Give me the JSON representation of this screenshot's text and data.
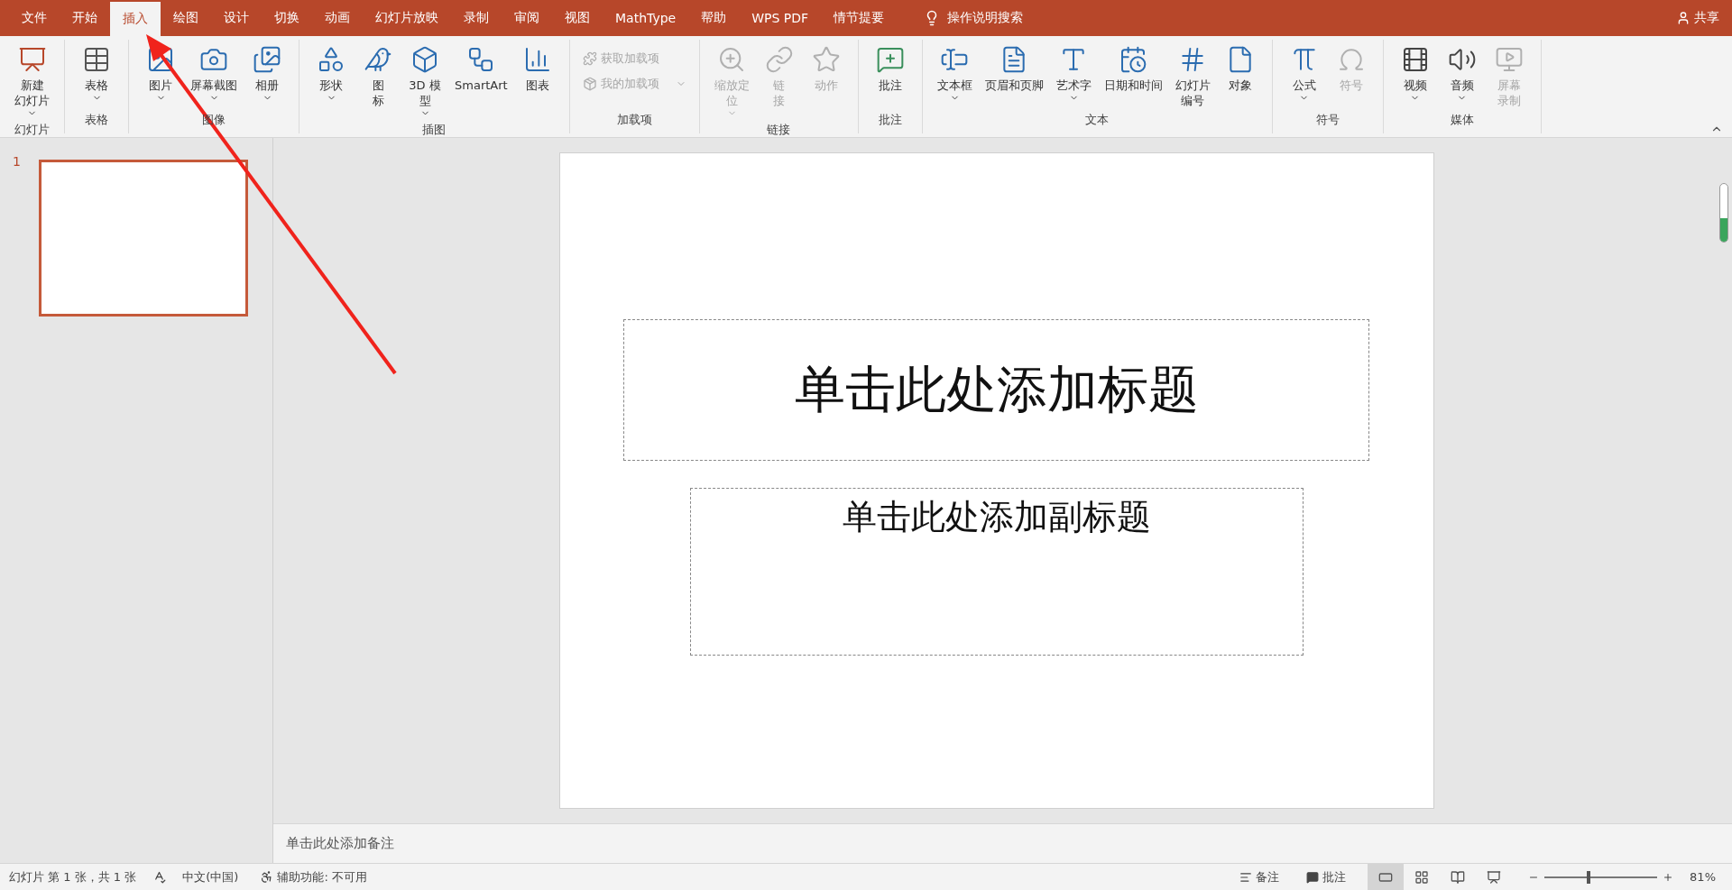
{
  "tabs": [
    {
      "label": "文件",
      "selected": false
    },
    {
      "label": "开始",
      "selected": false
    },
    {
      "label": "插入",
      "selected": true
    },
    {
      "label": "绘图",
      "selected": false
    },
    {
      "label": "设计",
      "selected": false
    },
    {
      "label": "切换",
      "selected": false
    },
    {
      "label": "动画",
      "selected": false
    },
    {
      "label": "幻灯片放映",
      "selected": false
    },
    {
      "label": "录制",
      "selected": false
    },
    {
      "label": "审阅",
      "selected": false
    },
    {
      "label": "视图",
      "selected": false
    },
    {
      "label": "MathType",
      "selected": false
    },
    {
      "label": "帮助",
      "selected": false
    },
    {
      "label": "WPS PDF",
      "selected": false
    },
    {
      "label": "情节提要",
      "selected": false
    }
  ],
  "tell_me": "操作说明搜索",
  "share": "共享",
  "ribbon_groups": [
    {
      "label": "幻灯片",
      "items": [
        {
          "kind": "large",
          "lines": [
            "新建",
            "幻灯片"
          ],
          "dropdown": true,
          "disabled": false
        }
      ]
    },
    {
      "label": "表格",
      "items": [
        {
          "kind": "large",
          "lines": [
            "表格"
          ],
          "dropdown": true,
          "disabled": false
        }
      ]
    },
    {
      "label": "图像",
      "items": [
        {
          "kind": "large",
          "lines": [
            "图片"
          ],
          "dropdown": true,
          "disabled": false
        },
        {
          "kind": "large",
          "lines": [
            "屏幕截图"
          ],
          "dropdown": true,
          "disabled": false
        },
        {
          "kind": "large",
          "lines": [
            "相册"
          ],
          "dropdown": true,
          "disabled": false
        }
      ]
    },
    {
      "label": "插图",
      "items": [
        {
          "kind": "large",
          "lines": [
            "形状"
          ],
          "dropdown": true,
          "disabled": false
        },
        {
          "kind": "large",
          "lines": [
            "图",
            "标"
          ],
          "dropdown": false,
          "disabled": false
        },
        {
          "kind": "large",
          "lines": [
            "3D 模",
            "型"
          ],
          "dropdown": true,
          "disabled": false
        },
        {
          "kind": "large",
          "lines": [
            "SmartArt"
          ],
          "dropdown": false,
          "disabled": false
        },
        {
          "kind": "large",
          "lines": [
            "图表"
          ],
          "dropdown": false,
          "disabled": false
        }
      ]
    },
    {
      "label": "加载项",
      "items": [
        {
          "kind": "small",
          "lines": [
            "获取加载项"
          ],
          "dropdown": false,
          "disabled": true
        },
        {
          "kind": "small",
          "lines": [
            "我的加载项"
          ],
          "dropdown": true,
          "disabled": true
        }
      ]
    },
    {
      "label": "链接",
      "items": [
        {
          "kind": "large",
          "lines": [
            "缩放定",
            "位"
          ],
          "dropdown": true,
          "disabled": true
        },
        {
          "kind": "large",
          "lines": [
            "链",
            "接"
          ],
          "dropdown": false,
          "disabled": true
        },
        {
          "kind": "large",
          "lines": [
            "动作"
          ],
          "dropdown": false,
          "disabled": true
        }
      ]
    },
    {
      "label": "批注",
      "items": [
        {
          "kind": "large",
          "lines": [
            "批注"
          ],
          "dropdown": false,
          "disabled": false
        }
      ]
    },
    {
      "label": "文本",
      "items": [
        {
          "kind": "large",
          "lines": [
            "文本框"
          ],
          "dropdown": true,
          "disabled": false
        },
        {
          "kind": "large",
          "lines": [
            "页眉和页脚"
          ],
          "dropdown": false,
          "disabled": false
        },
        {
          "kind": "large",
          "lines": [
            "艺术字"
          ],
          "dropdown": true,
          "disabled": false
        },
        {
          "kind": "large",
          "lines": [
            "日期和时间"
          ],
          "dropdown": false,
          "disabled": false
        },
        {
          "kind": "large",
          "lines": [
            "幻灯片",
            "编号"
          ],
          "dropdown": false,
          "disabled": false
        },
        {
          "kind": "large",
          "lines": [
            "对象"
          ],
          "dropdown": false,
          "disabled": false
        }
      ]
    },
    {
      "label": "符号",
      "items": [
        {
          "kind": "large",
          "lines": [
            "公式"
          ],
          "dropdown": true,
          "disabled": false
        },
        {
          "kind": "large",
          "lines": [
            "符号"
          ],
          "dropdown": false,
          "disabled": true
        }
      ]
    },
    {
      "label": "媒体",
      "items": [
        {
          "kind": "large",
          "lines": [
            "视频"
          ],
          "dropdown": true,
          "disabled": false
        },
        {
          "kind": "large",
          "lines": [
            "音频"
          ],
          "dropdown": true,
          "disabled": false
        },
        {
          "kind": "large",
          "lines": [
            "屏幕",
            "录制"
          ],
          "dropdown": false,
          "disabled": true
        }
      ]
    }
  ],
  "slides": [
    {
      "number": "1",
      "selected": true
    }
  ],
  "slide": {
    "title_placeholder": "单击此处添加标题",
    "subtitle_placeholder": "单击此处添加副标题"
  },
  "notes": {
    "placeholder": "单击此处添加备注"
  },
  "status_bar": {
    "slide_info": "幻灯片 第 1 张，共 1 张",
    "language": "中文(中国)",
    "accessibility": "辅助功能: 不可用",
    "notes_button": "备注",
    "comments_button": "批注",
    "views": [
      {
        "selected": true
      },
      {
        "selected": false
      },
      {
        "selected": false
      },
      {
        "selected": false
      }
    ],
    "zoom": {
      "level": 0.39,
      "percent": "81%"
    }
  }
}
